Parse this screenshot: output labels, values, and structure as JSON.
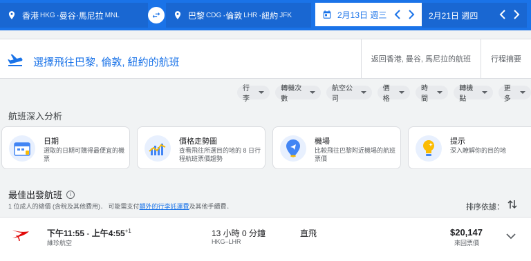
{
  "search": {
    "origin": {
      "city1": "香港",
      "code1": "HKG",
      "city2": "曼谷",
      "city3": "馬尼拉",
      "code3": "MNL",
      "sep": "·"
    },
    "destination": {
      "city1": "巴黎",
      "code1": "CDG",
      "city2": "倫敦",
      "code2": "LHR",
      "city3": "紐約",
      "code3": "JFK",
      "sep": "·"
    },
    "depart_date": "2月13日 週三",
    "return_date": "2月21日 週四"
  },
  "header": {
    "title": "選擇飛往巴黎, 倫敦, 紐約的航班",
    "breadcrumbs": [
      "返回香港, 曼谷, 馬尼拉的航班",
      "行程摘要"
    ]
  },
  "filters": [
    "行李",
    "轉機次數",
    "航空公司",
    "價格",
    "時間",
    "轉機點",
    "更多"
  ],
  "insights": {
    "title": "航班深入分析",
    "cards": [
      {
        "title": "日期",
        "desc": "選取的日期可購得最便宜的機票",
        "icon": "calendar-icon"
      },
      {
        "title": "價格走勢圖",
        "desc": "查看飛往所選目的地的 8 日行程航班票價趨勢",
        "icon": "price-graph-icon"
      },
      {
        "title": "機場",
        "desc": "比較飛往巴黎附近機場的航班票價",
        "icon": "airport-pin-icon"
      },
      {
        "title": "提示",
        "desc": "深入瞭解你的目的地",
        "icon": "lightbulb-icon"
      }
    ]
  },
  "best": {
    "title": "最佳出發航班",
    "note_prefix": "1 位成人的總價 (含稅及其他費用)． 可能需支付",
    "note_link": "額外的行李託運費",
    "note_suffix": "及其他手續費．",
    "sort_label": "排序依據："
  },
  "flight": {
    "dep_time": "下午11:55",
    "arr_time": "上午4:55",
    "day_offset": "+1",
    "time_sep": " - ",
    "airline": "維珍航空",
    "duration": "13 小時 0 分鐘",
    "route": "HKG–LHR",
    "stops": "直飛",
    "price": "$20,147",
    "price_type": "來回票價"
  },
  "colors": {
    "accent": "#1a73e8",
    "brand_red": "#e10a0a"
  }
}
